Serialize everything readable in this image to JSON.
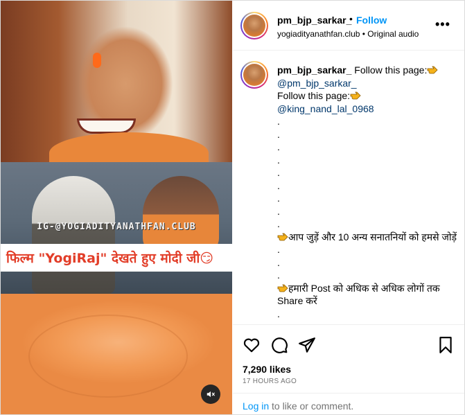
{
  "post": {
    "media": {
      "watermark": "IG-@YOGIADITYANATHFAN.CLUB",
      "overlay_text": "फिल्म \"YogiRaj\" देखते हुए मोदी जी😏",
      "mute_icon": "speaker-muted-icon"
    },
    "header": {
      "username": "pm_bjp_sarkar_",
      "separator": "•",
      "follow_label": "Follow",
      "account": "yogiadityanathfan.club",
      "sub_separator": " • ",
      "audio": "Original audio",
      "more_icon": "more-options-icon",
      "more_glyph": "•••"
    },
    "caption": {
      "username": "pm_bjp_sarkar_",
      "follow_text_1": "Follow this page:",
      "mention_1": "@pm_bjp_sarkar_",
      "follow_text_2": "Follow this page:",
      "mention_2": "@king_nand_lal_0968",
      "dot": ".",
      "hindi_line_1": "आप जुड़ें और 10 अन्य सनातनियों को हमसे जोड़ें",
      "hindi_line_2": "हमारी Post को अधिक से अधिक लोगों तक Share करें"
    },
    "actions": {
      "like_icon": "heart-icon",
      "comment_icon": "comment-icon",
      "share_icon": "share-icon",
      "save_icon": "bookmark-icon"
    },
    "likes": "7,290 likes",
    "timestamp": "17 HOURS AGO",
    "login": {
      "link_label": "Log in",
      "rest": " to like or comment."
    },
    "colors": {
      "follow_blue": "#0095f6",
      "mention": "#00376b",
      "overlay_red": "#e23d28"
    }
  }
}
